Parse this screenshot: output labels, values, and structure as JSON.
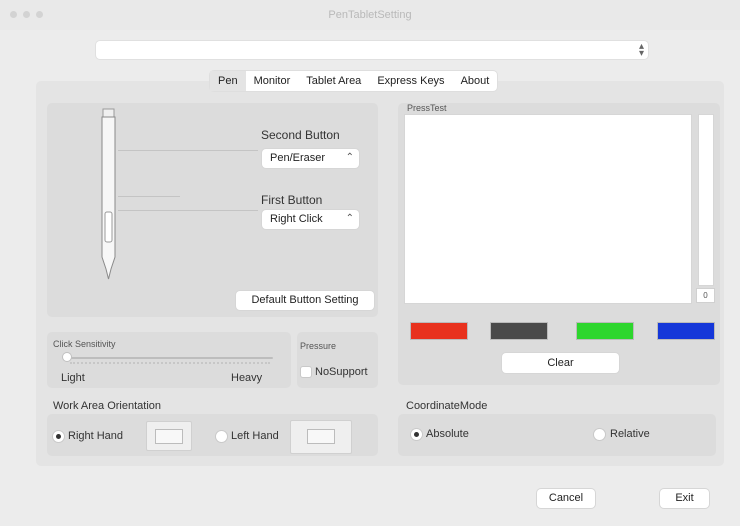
{
  "window": {
    "title": "PenTabletSetting"
  },
  "device_select": {
    "value": ""
  },
  "tabs": [
    {
      "label": "Pen",
      "active": true
    },
    {
      "label": "Monitor",
      "active": false
    },
    {
      "label": "Tablet Area",
      "active": false
    },
    {
      "label": "Express Keys",
      "active": false
    },
    {
      "label": "About",
      "active": false
    }
  ],
  "pen": {
    "second_button_label": "Second Button",
    "second_button_value": "Pen/Eraser",
    "first_button_label": "First Button",
    "first_button_value": "Right Click",
    "default_button": "Default  Button Setting"
  },
  "click_sensitivity": {
    "title": "Click Sensitivity",
    "min_label": "Light",
    "max_label": "Heavy",
    "level": 0.0
  },
  "pressure": {
    "title": "Pressure",
    "checkbox_label": "NoSupport",
    "checked": false
  },
  "orientation": {
    "title": "Work Area Orientation",
    "right_label": "Right Hand",
    "left_label": "Left Hand",
    "selected": "right"
  },
  "press_test": {
    "title": "PressTest",
    "value": "0",
    "colors": [
      "#e8321e",
      "#4a4a4a",
      "#2ed62e",
      "#1537d9"
    ],
    "clear_label": "Clear"
  },
  "coordinate_mode": {
    "title": "CoordinateMode",
    "absolute_label": "Absolute",
    "relative_label": "Relative",
    "selected": "absolute"
  },
  "footer": {
    "cancel_label": "Cancel",
    "exit_label": "Exit"
  }
}
